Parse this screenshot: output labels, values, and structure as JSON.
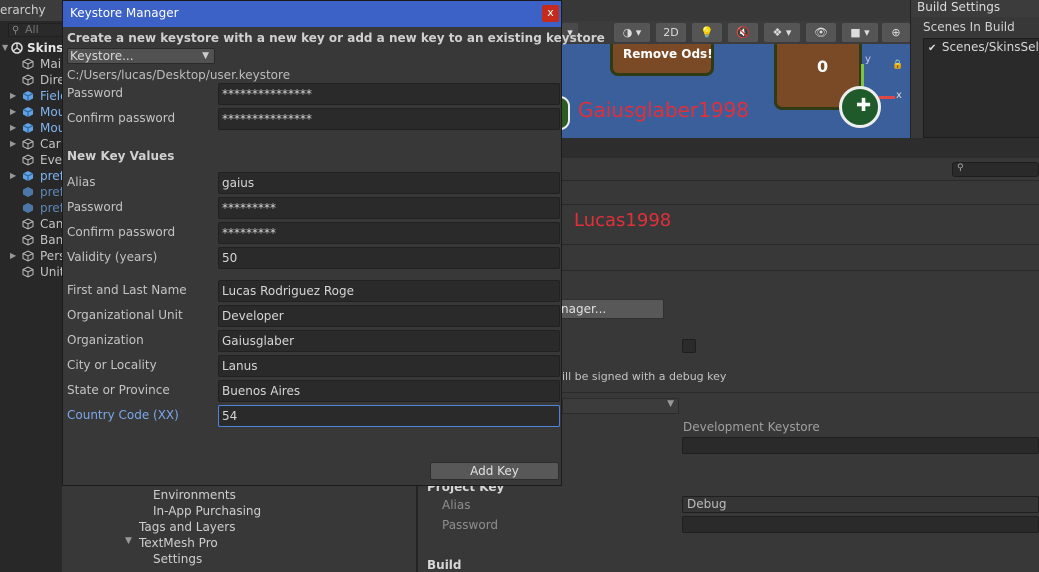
{
  "hierarchy": {
    "tab_label": "erarchy",
    "search_placeholder": "All",
    "items": [
      {
        "label": "SkinsS"
      },
      {
        "label": "Mai"
      },
      {
        "label": "Dire"
      },
      {
        "label": "Field"
      },
      {
        "label": "Mou"
      },
      {
        "label": "Mou"
      },
      {
        "label": "Car"
      },
      {
        "label": "Eve"
      },
      {
        "label": "pref"
      },
      {
        "label": "pref"
      },
      {
        "label": "pref"
      },
      {
        "label": "Can"
      },
      {
        "label": "Ban"
      },
      {
        "label": "Pers"
      },
      {
        "label": "Unit"
      }
    ]
  },
  "scene_toolbar": {
    "mode_2d": "2D"
  },
  "scene": {
    "sign_text": "Remove Ods!",
    "counter": "0",
    "axis_y": "y",
    "axis_x": "x"
  },
  "watermarks": {
    "top": "Gaiusglaber1998",
    "mid": "Lucas1998"
  },
  "build_settings": {
    "tab_label": "Build Settings",
    "scenes_header": "Scenes In Build",
    "scenes": [
      {
        "path": "Scenes/SkinsSele",
        "checked": true
      }
    ]
  },
  "project_settings": {
    "manager_button": "nager...",
    "debug_note": "ill be signed with a debug key",
    "dev_keystore_label": "Development Keystore",
    "project_key_header": "Project Key",
    "alias_label": "Alias",
    "alias_value": "Debug",
    "password_label": "Password",
    "build_header": "Build",
    "tree": [
      {
        "label": "Environments"
      },
      {
        "label": "In-App Purchasing"
      },
      {
        "label": "Tags and Layers"
      },
      {
        "label": "TextMesh Pro"
      },
      {
        "label": "Settings"
      }
    ]
  },
  "keystore_dialog": {
    "title": "Keystore Manager",
    "close_glyph": "x",
    "heading": "Create a new keystore with a new key or add a new key to an existing keystore",
    "keystore_dropdown": "Keystore...",
    "keystore_path": "C:/Users/lucas/Desktop/user.keystore",
    "keystore_fields": [
      {
        "label": "Password",
        "value": "***************"
      },
      {
        "label": "Confirm password",
        "value": "***************"
      }
    ],
    "section_title": "New Key Values",
    "key_fields": [
      {
        "label": "Alias",
        "value": "gaius"
      },
      {
        "label": "Password",
        "value": "*********"
      },
      {
        "label": "Confirm password",
        "value": "*********"
      },
      {
        "label": "Validity (years)",
        "value": "50"
      }
    ],
    "identity_fields": [
      {
        "label": "First and Last Name",
        "value": "Lucas Rodriguez Roge"
      },
      {
        "label": "Organizational Unit",
        "value": "Developer"
      },
      {
        "label": "Organization",
        "value": "Gaiusglaber"
      },
      {
        "label": "City or Locality",
        "value": "Lanus"
      },
      {
        "label": "State or Province",
        "value": "Buenos Aires"
      },
      {
        "label": "Country Code (XX)",
        "value": "54"
      }
    ],
    "add_key_button": "Add Key"
  },
  "colors": {
    "title_bar": "#3c62c8",
    "close_button": "#c42b1c",
    "focus_label": "#7ba7e8",
    "watermark": "#e0303a",
    "scene_bg": "#3b5f9a"
  }
}
